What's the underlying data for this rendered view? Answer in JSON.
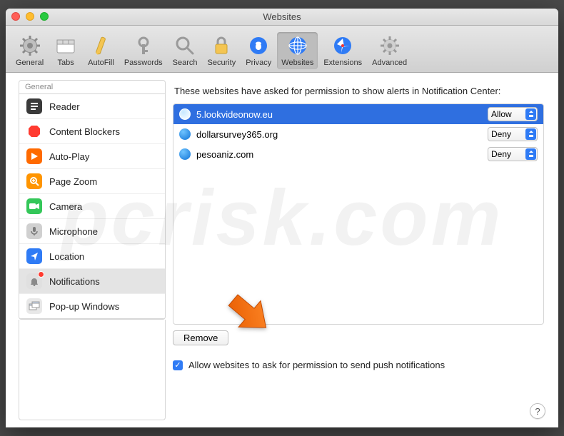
{
  "window_title": "Websites",
  "toolbar": [
    {
      "id": "general",
      "label": "General"
    },
    {
      "id": "tabs",
      "label": "Tabs"
    },
    {
      "id": "autofill",
      "label": "AutoFill"
    },
    {
      "id": "passwords",
      "label": "Passwords"
    },
    {
      "id": "search",
      "label": "Search"
    },
    {
      "id": "security",
      "label": "Security"
    },
    {
      "id": "privacy",
      "label": "Privacy"
    },
    {
      "id": "websites",
      "label": "Websites",
      "active": true
    },
    {
      "id": "extensions",
      "label": "Extensions"
    },
    {
      "id": "advanced",
      "label": "Advanced"
    }
  ],
  "sidebar": {
    "group_label": "General",
    "items": [
      {
        "id": "reader",
        "label": "Reader"
      },
      {
        "id": "content-blockers",
        "label": "Content Blockers"
      },
      {
        "id": "auto-play",
        "label": "Auto-Play"
      },
      {
        "id": "page-zoom",
        "label": "Page Zoom"
      },
      {
        "id": "camera",
        "label": "Camera"
      },
      {
        "id": "microphone",
        "label": "Microphone"
      },
      {
        "id": "location",
        "label": "Location"
      },
      {
        "id": "notifications",
        "label": "Notifications",
        "selected": true,
        "badge": true
      },
      {
        "id": "popup",
        "label": "Pop-up Windows"
      }
    ]
  },
  "main": {
    "header": "These websites have asked for permission to show alerts in Notification Center:",
    "sites": [
      {
        "name": "5.lookvideonow.eu",
        "permission": "Allow",
        "selected": true
      },
      {
        "name": "dollarsurvey365.org",
        "permission": "Deny"
      },
      {
        "name": "pesoaniz.com",
        "permission": "Deny"
      }
    ],
    "permission_options": [
      "Allow",
      "Deny"
    ],
    "remove_label": "Remove",
    "checkbox_label": "Allow websites to ask for permission to send push notifications",
    "checkbox_checked": true
  },
  "help_label": "?"
}
